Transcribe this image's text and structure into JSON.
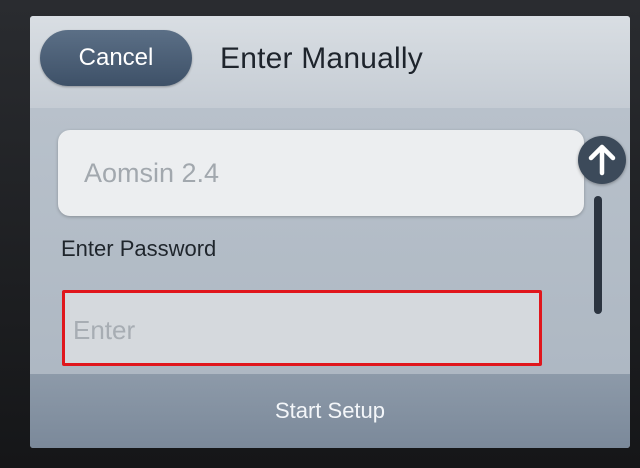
{
  "header": {
    "cancel_label": "Cancel",
    "title": "Enter Manually"
  },
  "ssid_field": {
    "value": "Aomsin 2.4"
  },
  "password": {
    "label": "Enter Password",
    "placeholder": "Enter",
    "highlight_color": "#e0161c"
  },
  "scroll": {
    "up_icon": "arrow-up-icon"
  },
  "footer": {
    "start_setup_label": "Start Setup"
  },
  "colors": {
    "accent": "#4a5d74",
    "footer": "#8494a4"
  }
}
